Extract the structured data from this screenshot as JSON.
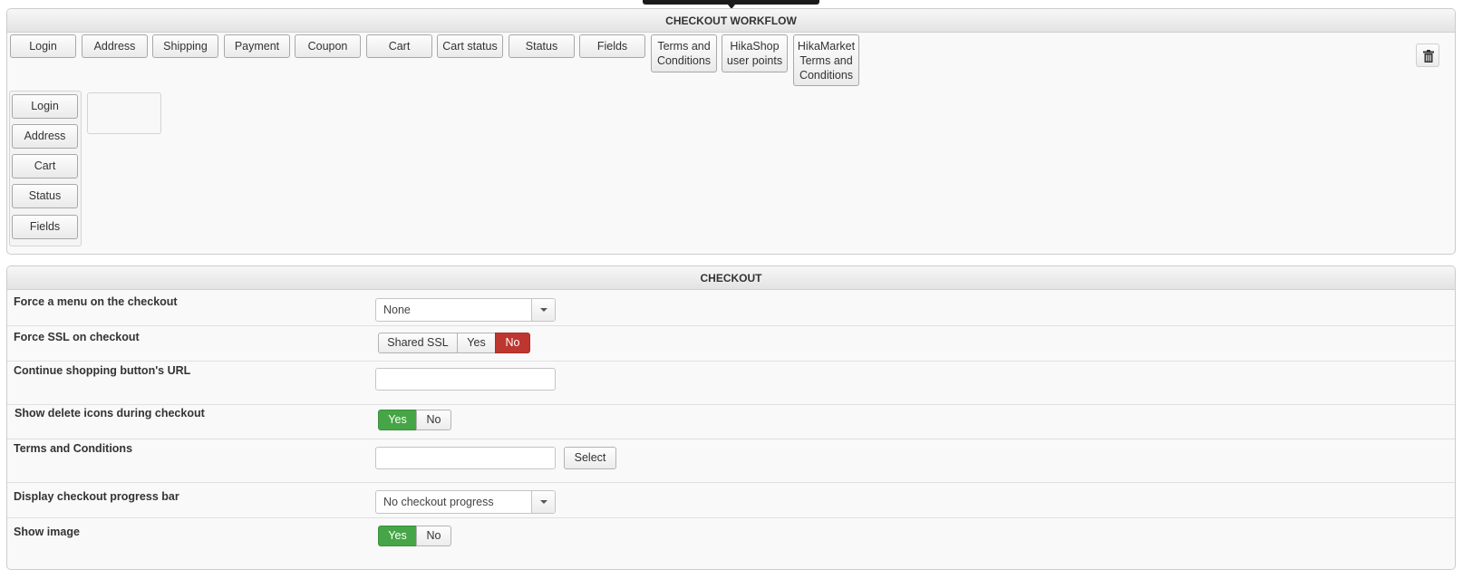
{
  "workflow": {
    "title": "CHECKOUT WORKFLOW",
    "available_steps": [
      "Login",
      "Address",
      "Shipping",
      "Payment",
      "Coupon",
      "Cart",
      "Cart status",
      "Status",
      "Fields",
      "Terms and Conditions",
      "HikaShop user points",
      "HikaMarket Terms and Conditions"
    ],
    "step_column": [
      "Login",
      "Address",
      "Cart",
      "Status",
      "Fields"
    ],
    "trash_icon": "trash-icon"
  },
  "checkout": {
    "title": "CHECKOUT",
    "force_menu": {
      "label": "Force a menu on the checkout",
      "value": "None"
    },
    "force_ssl": {
      "label": "Force SSL on checkout",
      "options": [
        "Shared SSL",
        "Yes",
        "No"
      ],
      "selected": "No"
    },
    "continue_url": {
      "label": "Continue shopping button's URL",
      "value": ""
    },
    "delete_icons": {
      "label": "Show delete icons during checkout",
      "options": [
        "Yes",
        "No"
      ],
      "selected": "Yes"
    },
    "terms": {
      "label": "Terms and Conditions",
      "value": "",
      "button": "Select"
    },
    "progress_bar": {
      "label": "Display checkout progress bar",
      "value": "No checkout progress"
    },
    "show_image": {
      "label": "Show image",
      "options": [
        "Yes",
        "No"
      ],
      "selected": "Yes"
    }
  },
  "colors": {
    "active_red": "#bd362f",
    "active_green": "#46a546"
  }
}
